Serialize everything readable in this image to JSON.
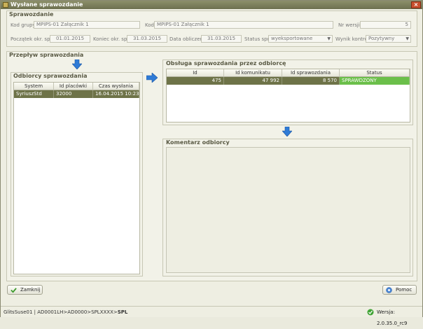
{
  "window": {
    "title": "Wysłane sprawozdanie"
  },
  "sprawozdanie": {
    "group_title": "Sprawozdanie",
    "kod_grupy_label": "Kod grupy",
    "kod_grupy_value": "MPIPS-01 Załącznik 1",
    "kod_label": "Kod",
    "kod_value": "MPIPS-01 Załącznik 1",
    "nr_wersji_label": "Nr wersji",
    "nr_wersji_value": "5",
    "poczatek_label": "Początek okr. spr.",
    "poczatek_value": "01.01.2015",
    "koniec_label": "Koniec okr. spr.",
    "koniec_value": "31.03.2015",
    "data_obliczenia_label": "Data obliczenia",
    "data_obliczenia_value": "31.03.2015",
    "status_label": "Status spr.",
    "status_value": "wyeksportowane",
    "wynik_label": "Wynik kontroli",
    "wynik_value": "Pozytywny"
  },
  "przeplyw": {
    "group_title": "Przepływ sprawozdania",
    "odbiorcy_title": "Odbiorcy sprawozdania",
    "odbiorcy_columns": [
      "System",
      "Id placówki",
      "Czas wysłania"
    ],
    "odbiorcy_rows": [
      [
        "SyriuszStd",
        "32000",
        "16.04.2015 10:23"
      ]
    ],
    "obsluga_title": "Obsługa sprawozdania przez odbiorcę",
    "obsluga_columns": [
      "Id",
      "Id komunikatu",
      "Id sprawozdania",
      "Status"
    ],
    "obsluga_rows": [
      [
        "475",
        "47 992",
        "8 570",
        "SPRAWDZONY"
      ]
    ],
    "komentarz_title": "Komentarz odbiorcy"
  },
  "buttons": {
    "close_label": "Zamknij",
    "help_label": "Pomoc"
  },
  "statusbar": {
    "path_prefix": "GlitsSuse01 | AD0001LH>AD0000>SPLXXXX>",
    "path_bold": "SPL",
    "version": "Wersja: 2.0.35.0_rc9"
  },
  "colors": {
    "selected_row": "#6e7348",
    "status_ok": "#6bbf4a",
    "accent_arrow": "#2f7bd6"
  }
}
